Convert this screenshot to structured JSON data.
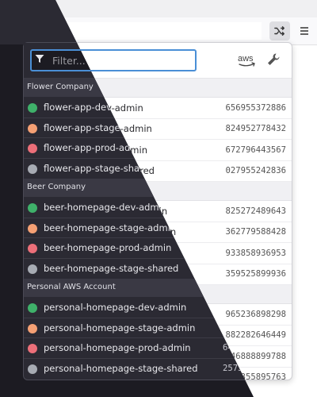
{
  "toolbar": {
    "extension_icon": "shuffle-icon",
    "menu_icon": "hamburger-menu-icon"
  },
  "popup": {
    "filter_placeholder": "Filter...",
    "aws_label": "aws",
    "settings_icon": "wrench-icon",
    "groups": [
      {
        "name": "Flower Company",
        "accounts": [
          {
            "name": "flower-app-dev-admin",
            "id": "656955372886",
            "color": "#3fb16a"
          },
          {
            "name": "flower-app-stage-admin",
            "id": "824952778432",
            "color": "#f5a074"
          },
          {
            "name": "flower-app-prod-admin",
            "id": "672796443567",
            "color": "#ec6f79"
          },
          {
            "name": "flower-app-stage-shared",
            "id": "027955242836",
            "color": "#a7abb3"
          }
        ]
      },
      {
        "name": "Beer Company",
        "accounts": [
          {
            "name": "beer-homepage-dev-admin",
            "id": "825272489643",
            "color": "#3fb16a"
          },
          {
            "name": "beer-homepage-stage-admin",
            "id": "362779588428",
            "color": "#f5a074"
          },
          {
            "name": "beer-homepage-prod-admin",
            "id": "933858936953",
            "color": "#ec6f79"
          },
          {
            "name": "beer-homepage-stage-shared",
            "id": "359525899936",
            "color": "#a7abb3"
          }
        ]
      },
      {
        "name": "Personal AWS Account",
        "accounts": [
          {
            "name": "personal-homepage-dev-admin",
            "id": "965236898298",
            "color": "#3fb16a"
          },
          {
            "name": "personal-homepage-stage-admin",
            "id": "882282646449",
            "color": "#f5a074"
          },
          {
            "name": "personal-homepage-prod-admin",
            "id": "646888899788",
            "color": "#ec6f79"
          },
          {
            "name": "personal-homepage-stage-shared",
            "id": "257355895763",
            "color": "#a7abb3"
          }
        ]
      }
    ]
  }
}
